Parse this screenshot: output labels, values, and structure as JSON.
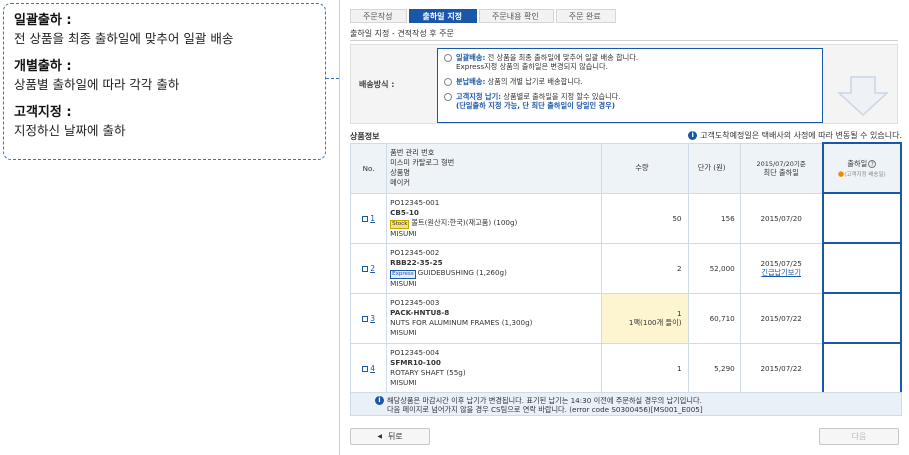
{
  "callout": {
    "items": [
      {
        "title": "일괄출하 :",
        "desc": "전 상품을 최종 출하일에 맞추어 일괄 배송"
      },
      {
        "title": "개별출하 :",
        "desc": "상품별 출하일에 따라 각각 출하"
      },
      {
        "title": "고객지정 :",
        "desc": "지정하신 날짜에 출하"
      }
    ]
  },
  "steps": [
    "주문작성",
    "출하일 지정",
    "주문내용 확인",
    "주문 완료"
  ],
  "active_step": 1,
  "order_title": "출하일 지정 - 견적작성 후 주문",
  "shipping": {
    "label": "배송방식 :",
    "options": [
      {
        "name": "일괄배송:",
        "text": "전 상품을 최종 출하일에 맞추어 일괄 배송 합니다.",
        "line2": "Express지정 상품의 출하일은 변경되지 않습니다."
      },
      {
        "name": "분납배송:",
        "text": "상품의 개별 납기로 배송합니다.",
        "line2": ""
      },
      {
        "name": "고객지정 납기:",
        "text": "상품별로 출하일을 지정 할수 있습니다.",
        "line2": "(단일출하 지정 가능, 단 최단 출하일이 당일인 경우)"
      }
    ]
  },
  "section": {
    "title": "상품정보",
    "note": "고객도착예정일은 택배사의 사정에 따라 변동될 수 있습니다."
  },
  "table": {
    "headers": {
      "no": "No.",
      "prod": [
        "품번 관리 번호",
        "미스미 카탈로그 형번",
        "상품명",
        "메이커"
      ],
      "qty": "수량",
      "price": "단가 (원)",
      "date_top": "2015/07/20기준",
      "date": "최단 출하일",
      "ship": "출하일",
      "ship_help": "?",
      "ship_note": "(고객지정 배송일)"
    },
    "rows": [
      {
        "no": "1",
        "code": "PO12345-001",
        "part": "CB5-10",
        "tag": "Stock",
        "tag_type": "stock",
        "name": "볼트(원산지:한국)(재고품) (100g)",
        "maker": "MISUMI",
        "qty": "50",
        "qty2": "",
        "price": "156",
        "date": "2015/07/20",
        "date_link": ""
      },
      {
        "no": "2",
        "code": "PO12345-002",
        "part": "RBB22-35-25",
        "tag": "Express",
        "tag_type": "express",
        "name": "GUIDEBUSHING (1,260g)",
        "maker": "MISUMI",
        "qty": "2",
        "qty2": "",
        "price": "52,000",
        "date": "2015/07/25",
        "date_link": "긴급납기보기"
      },
      {
        "no": "3",
        "code": "PO12345-003",
        "part": "PACK-HNTU8-8",
        "tag": "",
        "tag_type": "",
        "name": "NUTS FOR ALUMINUM FRAMES (1,300g)",
        "maker": "MISUMI",
        "qty": "1",
        "qty2": "1팩(100개 들이)",
        "price": "60,710",
        "date": "2015/07/22",
        "date_link": ""
      },
      {
        "no": "4",
        "code": "PO12345-004",
        "part": "SFMR10-100",
        "tag": "",
        "tag_type": "",
        "name": "ROTARY SHAFT (55g)",
        "maker": "MISUMI",
        "qty": "1",
        "qty2": "",
        "price": "5,290",
        "date": "2015/07/22",
        "date_link": ""
      }
    ]
  },
  "notice": {
    "line1": "해당상품은 마감시간 이후 납기가 변경됩니다. 표기된 납기는 14:30 이전에 주문하실 경우의 납기입니다.",
    "line2": "다음 페이지로 넘어가지 않을 경우 CS팀으로 연락 바랍니다. (error code S0300456)[MS001_E005]"
  },
  "buttons": {
    "back": "뒤로",
    "next": "다음"
  },
  "colors": {
    "accent": "#1a57a8",
    "callout_border": "#3c72b6",
    "stock_tag": "#f7e27a",
    "qty_highlight": "#fdf4d0"
  }
}
